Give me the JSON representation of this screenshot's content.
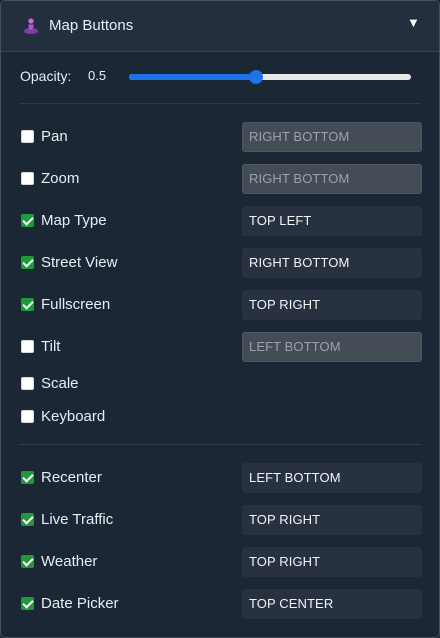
{
  "header": {
    "title": "Map Buttons",
    "collapse_icon": "triangle-down-icon",
    "logo_icon": "map-person-icon"
  },
  "opacity": {
    "label": "Opacity:",
    "value": "0.5",
    "fraction": 0.5
  },
  "controls": [
    {
      "label": "Pan",
      "checked": false,
      "position": "RIGHT BOTTOM",
      "disabled": true
    },
    {
      "label": "Zoom",
      "checked": false,
      "position": "RIGHT BOTTOM",
      "disabled": true
    },
    {
      "label": "Map Type",
      "checked": true,
      "position": "TOP LEFT",
      "disabled": false
    },
    {
      "label": "Street View",
      "checked": true,
      "position": "RIGHT BOTTOM",
      "disabled": false
    },
    {
      "label": "Fullscreen",
      "checked": true,
      "position": "TOP RIGHT",
      "disabled": false
    },
    {
      "label": "Tilt",
      "checked": false,
      "position": "LEFT BOTTOM",
      "disabled": true
    },
    {
      "label": "Scale",
      "checked": false
    },
    {
      "label": "Keyboard",
      "checked": false
    }
  ],
  "extras": [
    {
      "label": "Recenter",
      "checked": true,
      "position": "LEFT BOTTOM",
      "disabled": false
    },
    {
      "label": "Live Traffic",
      "checked": true,
      "position": "TOP RIGHT",
      "disabled": false
    },
    {
      "label": "Weather",
      "checked": true,
      "position": "TOP RIGHT",
      "disabled": false
    },
    {
      "label": "Date Picker",
      "checked": true,
      "position": "TOP CENTER",
      "disabled": false
    }
  ],
  "colors": {
    "accent": "#1a73e8",
    "checked": "#1e9a3a",
    "panel": "#1c2735"
  }
}
